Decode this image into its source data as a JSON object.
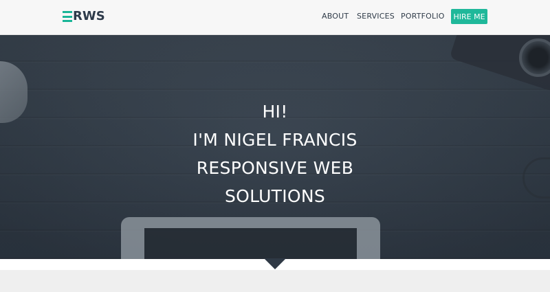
{
  "header": {
    "logo_text": "RWS",
    "nav": {
      "about": "ABOUT",
      "services": "SERVICES",
      "portfolio": "PORTFOLIO",
      "hire_me": "HIRE ME"
    },
    "colors": {
      "accent": "#1fb89a",
      "text": "#2f3b48",
      "background": "#f7f7f7"
    }
  },
  "hero": {
    "lines": [
      "HI!",
      "I'M NIGEL FRANCIS",
      "RESPONSIVE WEB",
      "SOLUTIONS"
    ],
    "colors": {
      "text": "#ffffff",
      "overlay": "#343f4b"
    }
  },
  "icons": {
    "logo_mark": "three-horizontal-bars",
    "section_arrow": "down-triangle"
  }
}
